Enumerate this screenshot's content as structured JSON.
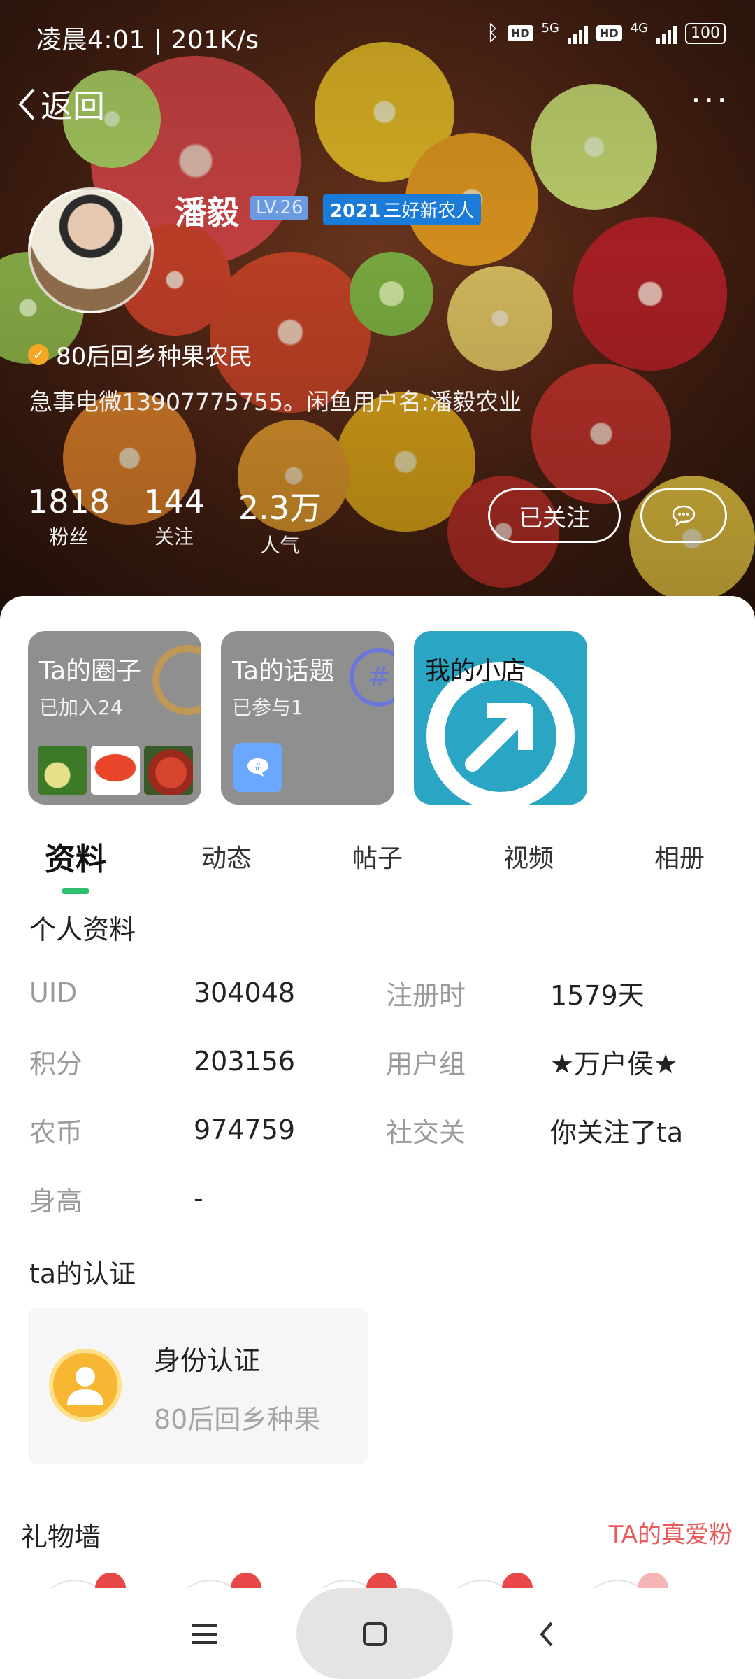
{
  "status_bar": {
    "time": "凌晨4:01 | 201K/s",
    "hd1": "HD",
    "net1": "5G",
    "hd2": "HD",
    "net2": "4G",
    "battery": "100"
  },
  "nav": {
    "back_label": "返回",
    "more_label": "···"
  },
  "profile": {
    "name": "潘毅",
    "level": "LV.26",
    "honor_year": "2021",
    "honor_text": "三好新农人",
    "verify_text": "80后回乡种果农民",
    "bio": "急事电微13907775755。闲鱼用户名:潘毅农业",
    "stats": [
      {
        "num": "1818",
        "label": "粉丝"
      },
      {
        "num": "144",
        "label": "关注"
      },
      {
        "num": "2.3万",
        "label": "人气"
      }
    ],
    "follow_label": "已关注"
  },
  "tiles": {
    "circle": {
      "title": "Ta的圈子",
      "sub": "已加入24"
    },
    "topic": {
      "title": "Ta的话题",
      "sub": "已参与1"
    },
    "shop": {
      "title": "我的小店"
    }
  },
  "tabs": [
    "资料",
    "动态",
    "帖子",
    "视频",
    "相册"
  ],
  "personal": {
    "title": "个人资料",
    "rows": [
      {
        "k1": "UID",
        "v1": "304048",
        "k2": "注册时",
        "v2": "1579天"
      },
      {
        "k1": "积分",
        "v1": "203156",
        "k2": "用户组",
        "v2": "★万户侯★"
      },
      {
        "k1": "农币",
        "v1": "974759",
        "k2": "社交关",
        "v2": "你关注了ta"
      },
      {
        "k1": "身高",
        "v1": "-",
        "k2": "",
        "v2": ""
      }
    ]
  },
  "certification": {
    "title": "ta的认证",
    "card_title": "身份认证",
    "card_sub": "80后回乡种果"
  },
  "gifts": {
    "title": "礼物墙",
    "link": "TA的真爱粉"
  }
}
